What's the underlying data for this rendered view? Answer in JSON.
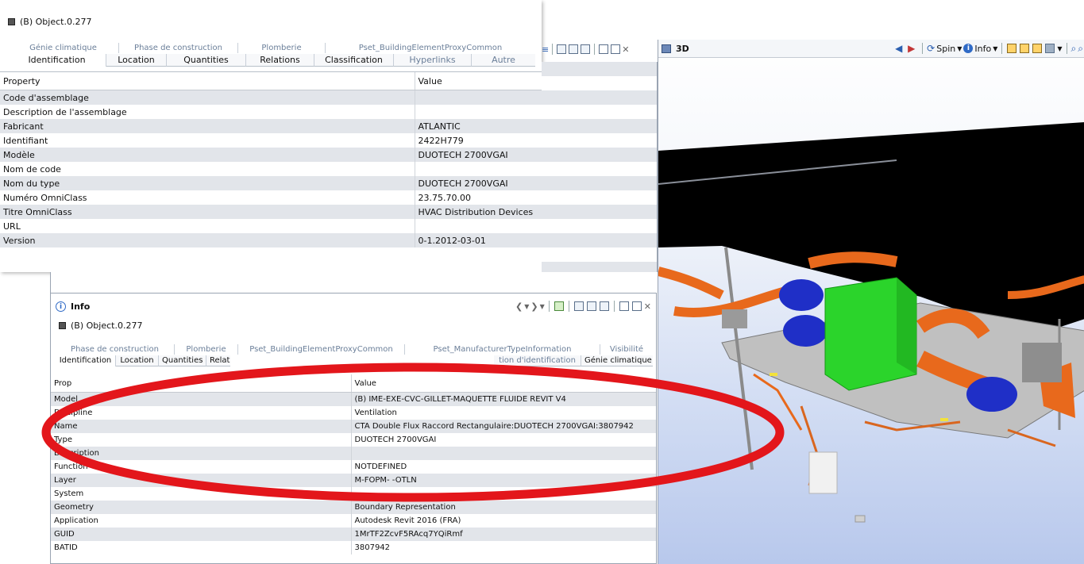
{
  "back_panel": {
    "title": "3D",
    "toolbar_icons": [
      "back-icon",
      "forward-icon",
      "spin-icon",
      "info-icon",
      "box-view-icon",
      "box-view-icon",
      "box-view-icon",
      "shade-icon",
      "zoom-icon",
      "zoom-icon"
    ],
    "spin_label": "Spin",
    "info_label": "Info"
  },
  "top_panel": {
    "object_label": "(B) Object.0.277",
    "tabs_back": [
      "Génie climatique",
      "Phase de construction",
      "Plomberie",
      "Pset_BuildingElementProxyCommon"
    ],
    "tabs_front": [
      "Identification",
      "Location",
      "Quantities",
      "Relations",
      "Classification",
      "Hyperlinks",
      "Autre"
    ],
    "table": {
      "headers": [
        "Property",
        "Value"
      ],
      "rows": [
        [
          "Code d'assemblage",
          ""
        ],
        [
          "Description de l'assemblage",
          ""
        ],
        [
          "Fabricant",
          "ATLANTIC"
        ],
        [
          "Identifiant",
          "2422H779"
        ],
        [
          "Modèle",
          "DUOTECH 2700VGAI"
        ],
        [
          "Nom de code",
          ""
        ],
        [
          "Nom du type",
          "DUOTECH 2700VGAI"
        ],
        [
          "Numéro OmniClass",
          "23.75.70.00"
        ],
        [
          "Titre OmniClass",
          "HVAC Distribution Devices"
        ],
        [
          "URL",
          ""
        ],
        [
          "Version",
          "0-1.2012-03-01"
        ]
      ]
    }
  },
  "info_panel": {
    "title": "Info",
    "object_label": "(B) Object.0.277",
    "tabs_back": [
      "Phase de construction",
      "Plomberie",
      "Pset_BuildingElementProxyCommon",
      "Pset_ManufacturerTypeInformation",
      "Visibilité"
    ],
    "tabs_front": [
      "Identification",
      "Location",
      "Quantities",
      "Relati"
    ],
    "tabs_front_right": [
      "tion d'identification",
      "Génie climatique"
    ],
    "table": {
      "headers": [
        "Prop",
        "Value"
      ],
      "rows": [
        [
          "Model",
          "(B) IME-EXE-CVC-GILLET-MAQUETTE FLUIDE REVIT V4"
        ],
        [
          "Discipline",
          "Ventilation"
        ],
        [
          "Name",
          "CTA Double Flux Raccord Rectangulaire:DUOTECH 2700VGAI:3807942"
        ],
        [
          "Type",
          "DUOTECH 2700VGAI"
        ],
        [
          "Description",
          ""
        ],
        [
          "Function",
          "NOTDEFINED"
        ],
        [
          "Layer",
          "M-FOPM-     -OTLN"
        ],
        [
          "System",
          ""
        ],
        [
          "Geometry",
          "Boundary Representation"
        ],
        [
          "Application",
          "Autodesk Revit 2016 (FRA)"
        ],
        [
          "GUID",
          "1MrTF2ZcvF5RAcq7YQiRmf"
        ],
        [
          "BATID",
          "3807942"
        ]
      ]
    }
  },
  "annotation_color": "#e3161b"
}
